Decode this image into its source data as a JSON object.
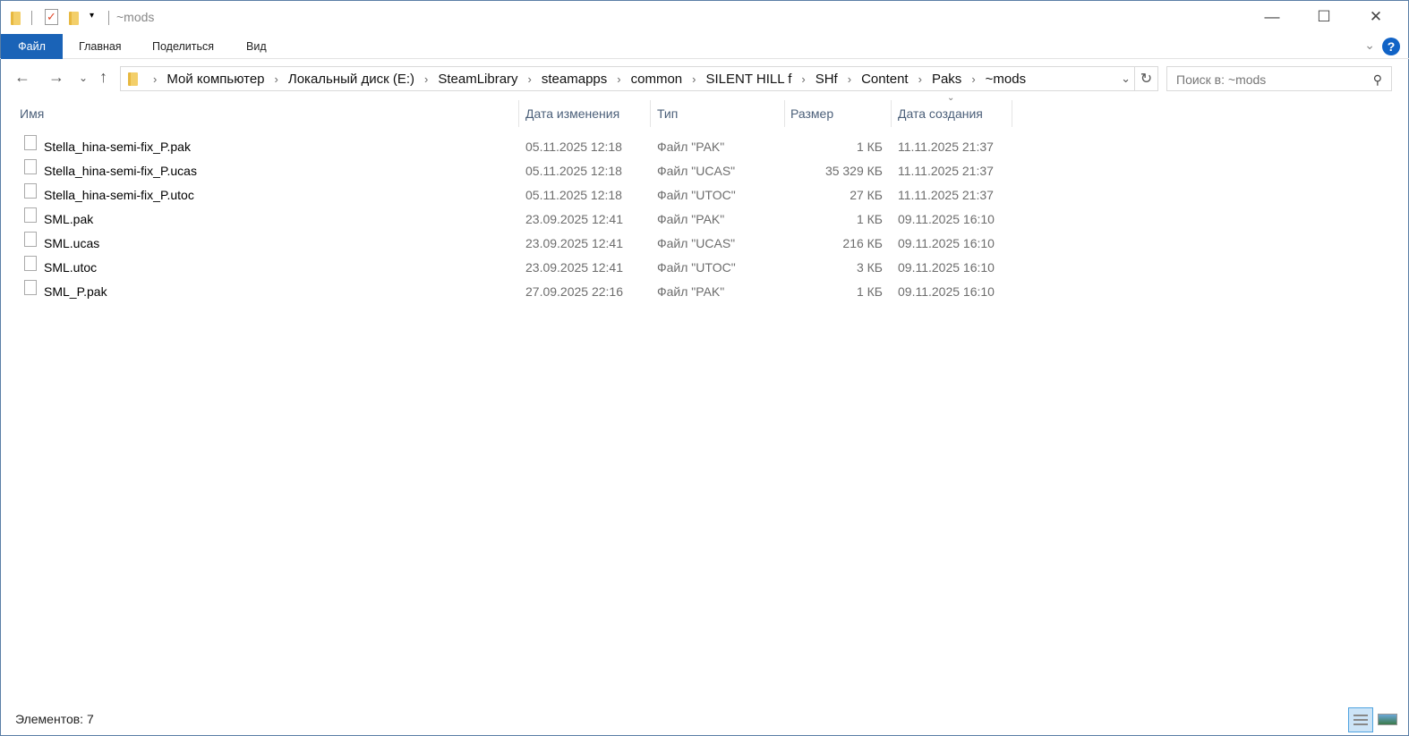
{
  "window": {
    "title": "~mods"
  },
  "ribbon": {
    "tabs": [
      "Файл",
      "Главная",
      "Поделиться",
      "Вид"
    ],
    "help": "?"
  },
  "address": {
    "crumbs": [
      "Мой компьютер",
      "Локальный диск (E:)",
      "SteamLibrary",
      "steamapps",
      "common",
      "SILENT HILL f",
      "SHf",
      "Content",
      "Paks",
      "~mods"
    ]
  },
  "search": {
    "placeholder": "Поиск в: ~mods"
  },
  "columns": {
    "name": "Имя",
    "modified": "Дата изменения",
    "type": "Тип",
    "size": "Размер",
    "created": "Дата создания"
  },
  "files": [
    {
      "name": "Stella_hina-semi-fix_P.pak",
      "modified": "05.11.2025 12:18",
      "type": "Файл \"PAK\"",
      "size": "1 КБ",
      "created": "11.11.2025 21:37"
    },
    {
      "name": "Stella_hina-semi-fix_P.ucas",
      "modified": "05.11.2025 12:18",
      "type": "Файл \"UCAS\"",
      "size": "35 329 КБ",
      "created": "11.11.2025 21:37"
    },
    {
      "name": "Stella_hina-semi-fix_P.utoc",
      "modified": "05.11.2025 12:18",
      "type": "Файл \"UTOC\"",
      "size": "27 КБ",
      "created": "11.11.2025 21:37"
    },
    {
      "name": "SML.pak",
      "modified": "23.09.2025 12:41",
      "type": "Файл \"PAK\"",
      "size": "1 КБ",
      "created": "09.11.2025 16:10"
    },
    {
      "name": "SML.ucas",
      "modified": "23.09.2025 12:41",
      "type": "Файл \"UCAS\"",
      "size": "216 КБ",
      "created": "09.11.2025 16:10"
    },
    {
      "name": "SML.utoc",
      "modified": "23.09.2025 12:41",
      "type": "Файл \"UTOC\"",
      "size": "3 КБ",
      "created": "09.11.2025 16:10"
    },
    {
      "name": "SML_P.pak",
      "modified": "27.09.2025 22:16",
      "type": "Файл \"PAK\"",
      "size": "1 КБ",
      "created": "09.11.2025 16:10"
    }
  ],
  "status": {
    "items": "Элементов: 7"
  }
}
